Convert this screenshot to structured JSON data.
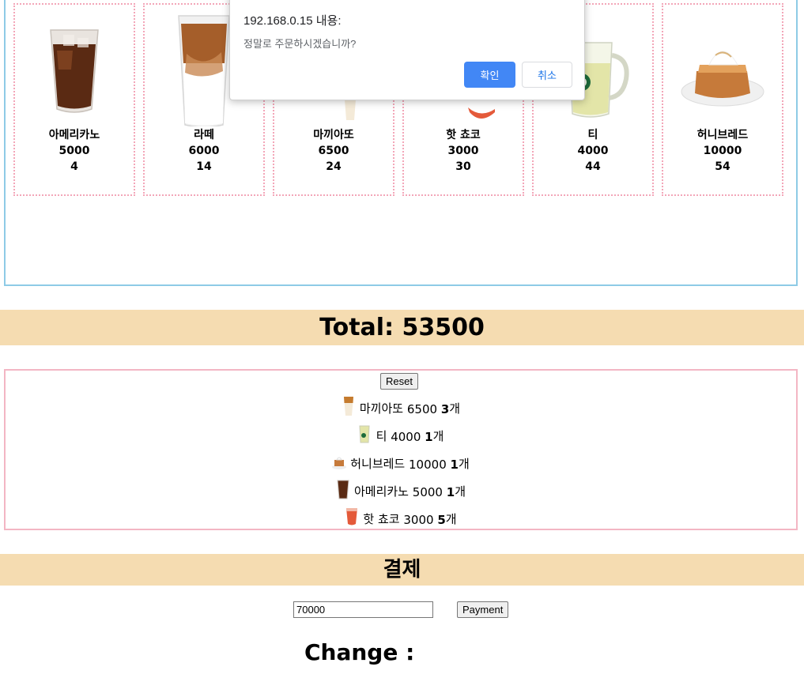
{
  "menu": {
    "items": [
      {
        "name": "아메리카노",
        "price": "5000",
        "count": "4",
        "icon": "iced-americano-icon"
      },
      {
        "name": "라떼",
        "price": "6000",
        "count": "14",
        "icon": "iced-latte-icon"
      },
      {
        "name": "마끼아또",
        "price": "6500",
        "count": "24",
        "icon": "macchiato-icon"
      },
      {
        "name": "핫 쵸코",
        "price": "3000",
        "count": "30",
        "icon": "hot-chocolate-icon"
      },
      {
        "name": "티",
        "price": "4000",
        "count": "44",
        "icon": "tea-mug-icon"
      },
      {
        "name": "허니브레드",
        "price": "10000",
        "count": "54",
        "icon": "honey-bread-icon"
      }
    ]
  },
  "total": {
    "label": "Total: 53500"
  },
  "orders": {
    "reset_label": "Reset",
    "rows": [
      {
        "name": "마끼아또",
        "price": "6500",
        "qty": "3",
        "unit": "개"
      },
      {
        "name": "티",
        "price": "4000",
        "qty": "1",
        "unit": "개"
      },
      {
        "name": "허니브레드",
        "price": "10000",
        "qty": "1",
        "unit": "개"
      },
      {
        "name": "아메리카노",
        "price": "5000",
        "qty": "1",
        "unit": "개"
      },
      {
        "name": "핫 쵸코",
        "price": "3000",
        "qty": "5",
        "unit": "개"
      }
    ]
  },
  "payment": {
    "title": "결제",
    "input_value": "70000",
    "button_label": "Payment",
    "change_label": "Change :"
  },
  "dialog": {
    "title": "192.168.0.15 내용:",
    "message": "정말로 주문하시겠습니까?",
    "ok_label": "확인",
    "cancel_label": "취소"
  },
  "colors": {
    "menu_border": "#8ecbe6",
    "card_border": "#f3a6b8",
    "bar_bg": "#f5dcb1",
    "order_border": "#f3b6c4",
    "dialog_ok": "#4287f5"
  }
}
